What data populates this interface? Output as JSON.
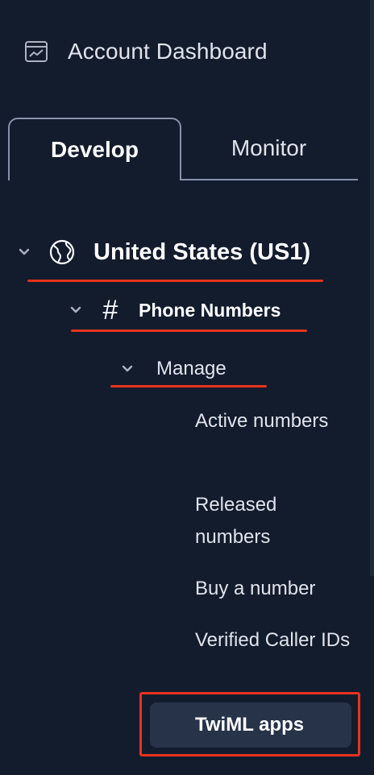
{
  "header": {
    "dashboard_label": "Account Dashboard",
    "dashboard_icon": "chart-line-icon"
  },
  "tabs": [
    {
      "label": "Develop",
      "active": true
    },
    {
      "label": "Monitor",
      "active": false
    }
  ],
  "nav": {
    "region": {
      "label": "United States (US1)",
      "icon": "globe-icon",
      "expanded": true
    },
    "phone_numbers": {
      "label": "Phone Numbers",
      "icon": "hash-icon",
      "expanded": true
    },
    "manage": {
      "label": "Manage",
      "expanded": true
    },
    "items": [
      {
        "label": "Active numbers"
      },
      {
        "label": "Released numbers"
      },
      {
        "label": "Buy a number"
      },
      {
        "label": "Verified Caller IDs"
      },
      {
        "label": "TwiML apps",
        "selected": true
      }
    ]
  },
  "colors": {
    "background": "#121c2d",
    "selected_bg": "#263349",
    "annotation_red": "#e8321d",
    "text": "#e1e3ea"
  }
}
